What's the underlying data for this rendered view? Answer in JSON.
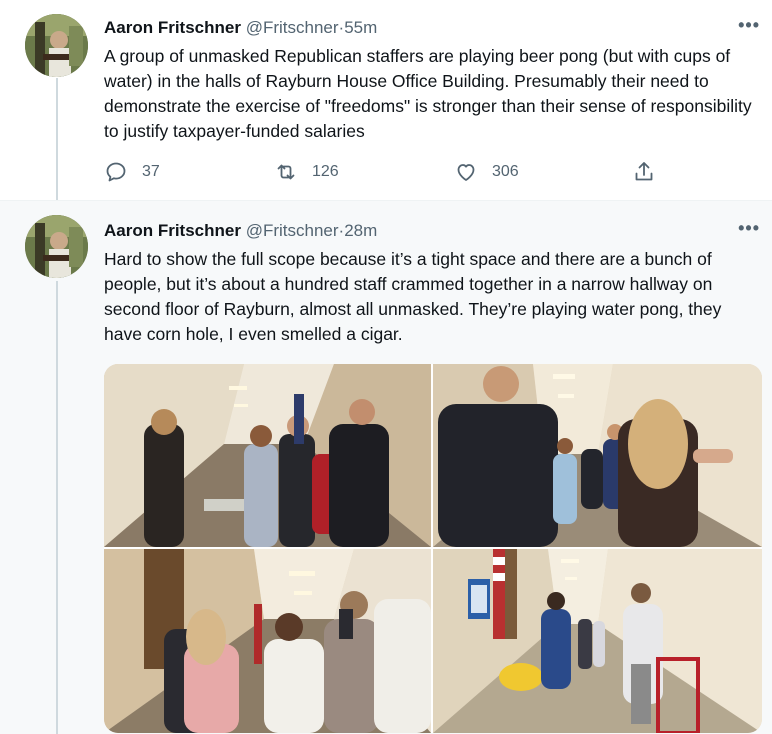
{
  "tweets": [
    {
      "name": "Aaron Fritschner",
      "handle": "@Fritschner",
      "separator": "·",
      "time": "55m",
      "more": "•••",
      "text": "A group of unmasked Republican staffers are playing beer pong (but with cups of water) in the halls of Rayburn House Office Building. Presumably their need to demonstrate the exercise of \"freedoms\" is stronger than their sense of responsibility to justify taxpayer-funded salaries",
      "actions": {
        "replies": "37",
        "retweets": "126",
        "likes": "306"
      }
    },
    {
      "name": "Aaron Fritschner",
      "handle": "@Fritschner",
      "separator": "·",
      "time": "28m",
      "more": "•••",
      "text": "Hard to show the full scope because it’s a tight space and there are a bunch of people, but it’s about a hundred staff crammed together in a narrow hallway on second floor of Rayburn, almost all unmasked. They’re playing water pong, they have corn hole, I even smelled a cigar."
    }
  ],
  "icons": {
    "reply": "reply-icon",
    "retweet": "retweet-icon",
    "like": "heart-icon",
    "share": "share-icon",
    "more": "more-icon"
  },
  "colors": {
    "text": "#0f1419",
    "secondary": "#536471",
    "thread_line": "#cfd9de",
    "selected_bg": "#f7f9fa"
  }
}
